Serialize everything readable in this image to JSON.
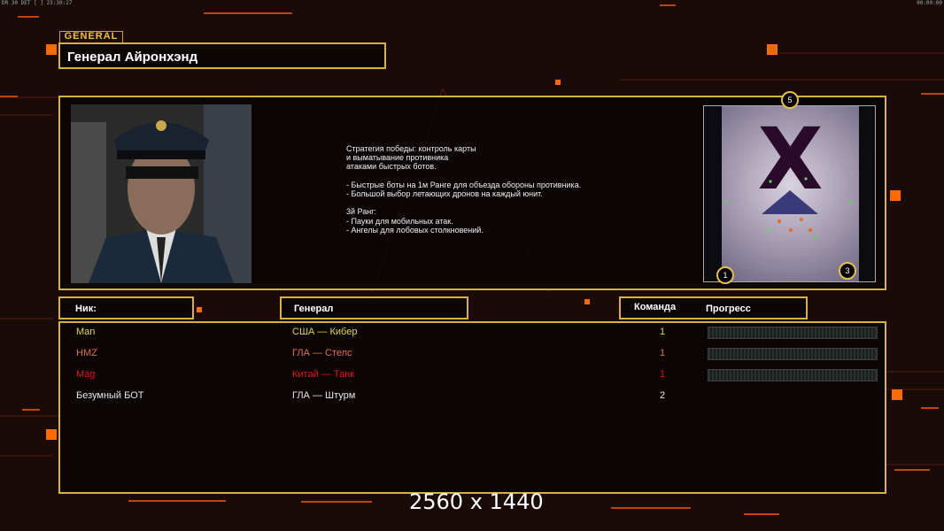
{
  "topbar": {
    "left": "DR 30 DET [ ] 23:30:27",
    "right": "00:00:00"
  },
  "general_tag": "GENERAL",
  "general_name": "Генерал Айронхэнд",
  "description": "Стратегия победы: контроль карты\nи выматывание противника\nатаками быстрых ботов.\n\n- Быстрые боты на 1м Ранге для объезда обороны противника.\n- Большой выбор летающих дронов на каждый юнит.\n\n3й Ранг:\n- Пауки для мобильных атак.\n- Ангелы для лобовых столкновений.",
  "map": {
    "label": "X",
    "badges": [
      "5",
      "1",
      "3"
    ]
  },
  "headers": {
    "nick": "Ник:",
    "general": "Генерал",
    "team": "Команда",
    "progress": "Прогресс"
  },
  "players": [
    {
      "nick": "Man",
      "general": "США — Кибер",
      "team": "1",
      "color": "#d8d64a",
      "progress": true
    },
    {
      "nick": "HMZ",
      "general": "ГЛА — Стелс",
      "team": "1",
      "color": "#e0704a",
      "progress": true
    },
    {
      "nick": "Mag",
      "general": "Китай — Танк",
      "team": "1",
      "color": "#e01818",
      "progress": true
    },
    {
      "nick": "Безумный БОТ",
      "general": "ГЛА — Штурм",
      "team": "2",
      "color": "#e6e6e6",
      "progress": false
    }
  ],
  "resolution": "2560 x 1440",
  "colors": {
    "accent": "#d8b23a",
    "background": "#1a0b08",
    "ornament": "#ff6a00"
  }
}
